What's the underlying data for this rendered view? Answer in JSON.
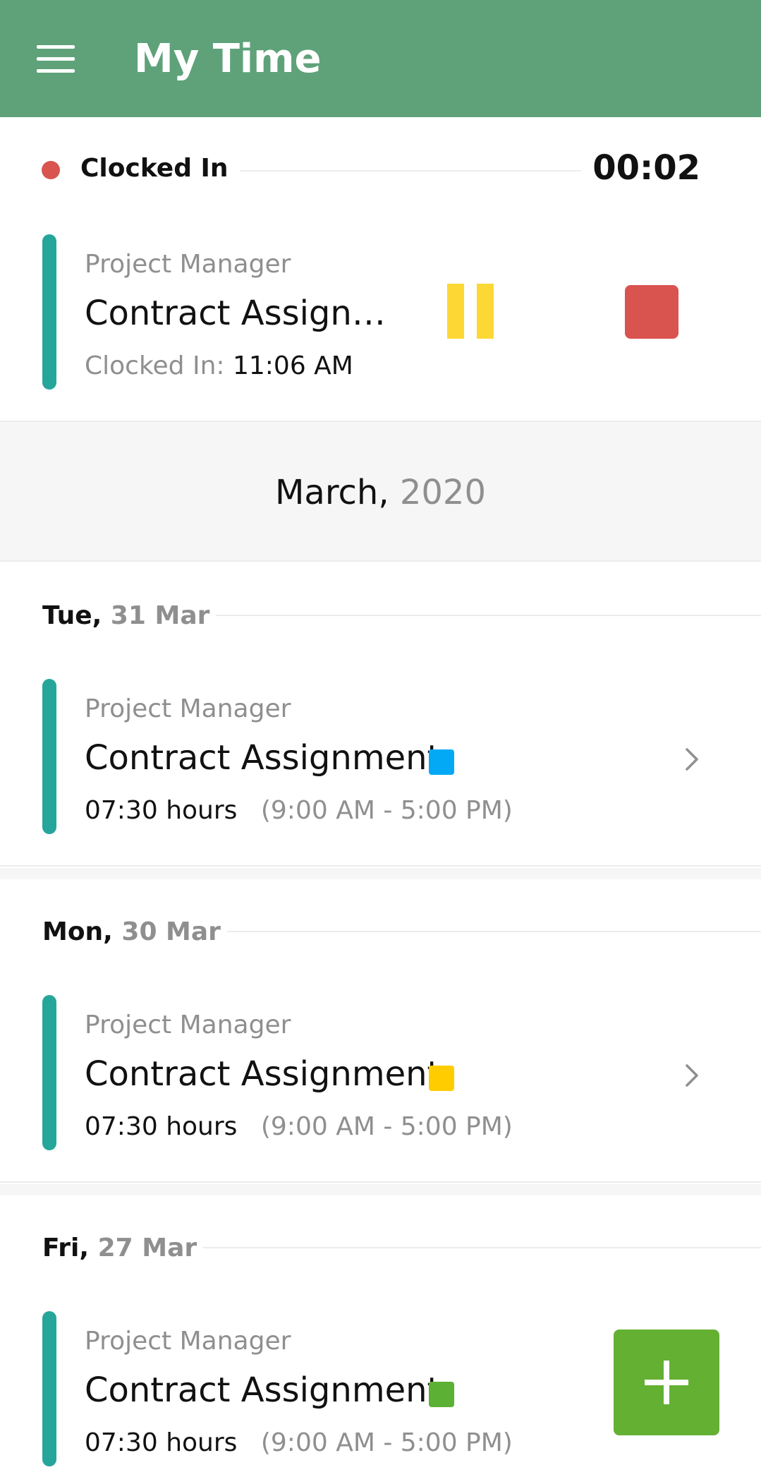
{
  "header": {
    "title": "My Time",
    "background": "#5fa27a"
  },
  "clock": {
    "status_label": "Clocked In",
    "status_color": "#d9534f",
    "timer": "00:02",
    "active_entry": {
      "role": "Project Manager",
      "project": "Contract Assignm...",
      "clocked_in_label": "Clocked In:",
      "clocked_in_time": "11:06 AM",
      "pause_color": "#fdd835",
      "stop_color": "#d9534f"
    }
  },
  "month": {
    "name": "March,",
    "year": "2020"
  },
  "days": [
    {
      "weekday": "Tue,",
      "date": "31 Mar",
      "entry": {
        "role": "Project Manager",
        "project": "Contract Assignment",
        "tag_color": "#03a9f4",
        "hours": "07:30 hours",
        "range": "(9:00 AM - 5:00 PM)"
      }
    },
    {
      "weekday": "Mon,",
      "date": "30 Mar",
      "entry": {
        "role": "Project Manager",
        "project": "Contract Assignment",
        "tag_color": "#ffcc00",
        "hours": "07:30 hours",
        "range": "(9:00 AM - 5:00 PM)"
      }
    },
    {
      "weekday": "Fri,",
      "date": "27 Mar",
      "entry": {
        "role": "Project Manager",
        "project": "Contract Assignment",
        "tag_color": "#5cb034",
        "hours": "07:30 hours",
        "range": "(9:00 AM - 5:00 PM)"
      }
    }
  ],
  "icons": {
    "menu": "hamburger-menu-icon",
    "pause": "pause-icon",
    "stop": "stop-icon",
    "chevron": "chevron-right-icon",
    "add": "plus-icon"
  },
  "colors": {
    "accent_bar": "#26a69a",
    "fab": "#63b032"
  }
}
